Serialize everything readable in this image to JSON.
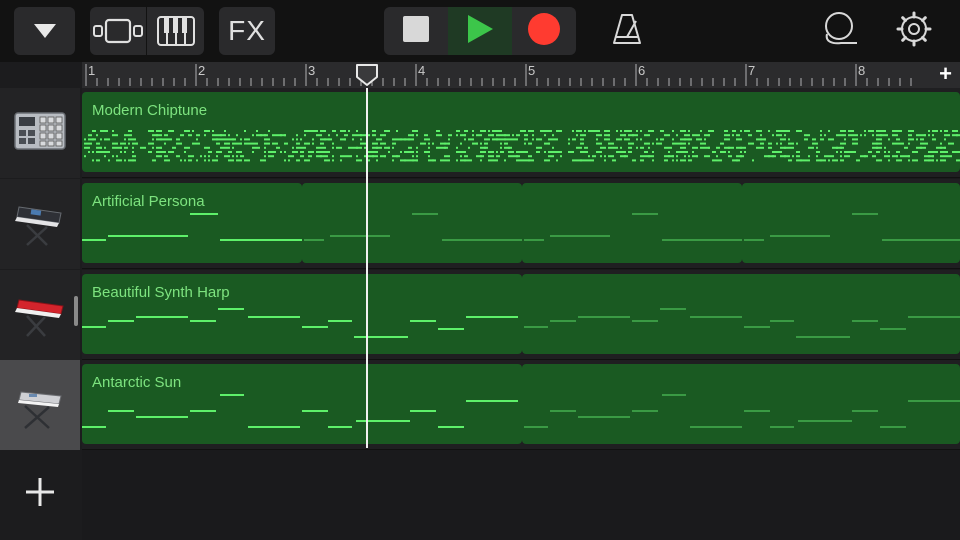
{
  "toolbar": {
    "menu_icon": "triangle-down-icon",
    "tracks_view_icon": "tracks-view-icon",
    "instrument_icon": "piano-keys-icon",
    "fx_label": "FX",
    "stop_icon": "stop-icon",
    "play_icon": "play-icon",
    "record_icon": "record-icon",
    "metronome_icon": "metronome-icon",
    "loop_icon": "loop-browser-icon",
    "settings_icon": "gear-icon",
    "play_color": "#3cc64a",
    "record_color": "#ff3b30"
  },
  "ruler": {
    "bars": [
      "1",
      "2",
      "3",
      "4",
      "5",
      "6",
      "7",
      "8"
    ],
    "add_label": "+"
  },
  "tracks": [
    {
      "name": "Modern Chiptune",
      "instrument_icon": "drum-machine-icon"
    },
    {
      "name": "Artificial Persona",
      "instrument_icon": "synth-keyboard-icon"
    },
    {
      "name": "Beautiful Synth Harp",
      "instrument_icon": "red-keyboard-icon"
    },
    {
      "name": "Antarctic Sun",
      "instrument_icon": "keyboard-stand-icon"
    }
  ],
  "add_track_label": "+",
  "colors": {
    "region": "#1a5a22",
    "region_text": "#7de37f",
    "note_bright": "#5ef06a",
    "note_dim": "#3a9a44"
  }
}
